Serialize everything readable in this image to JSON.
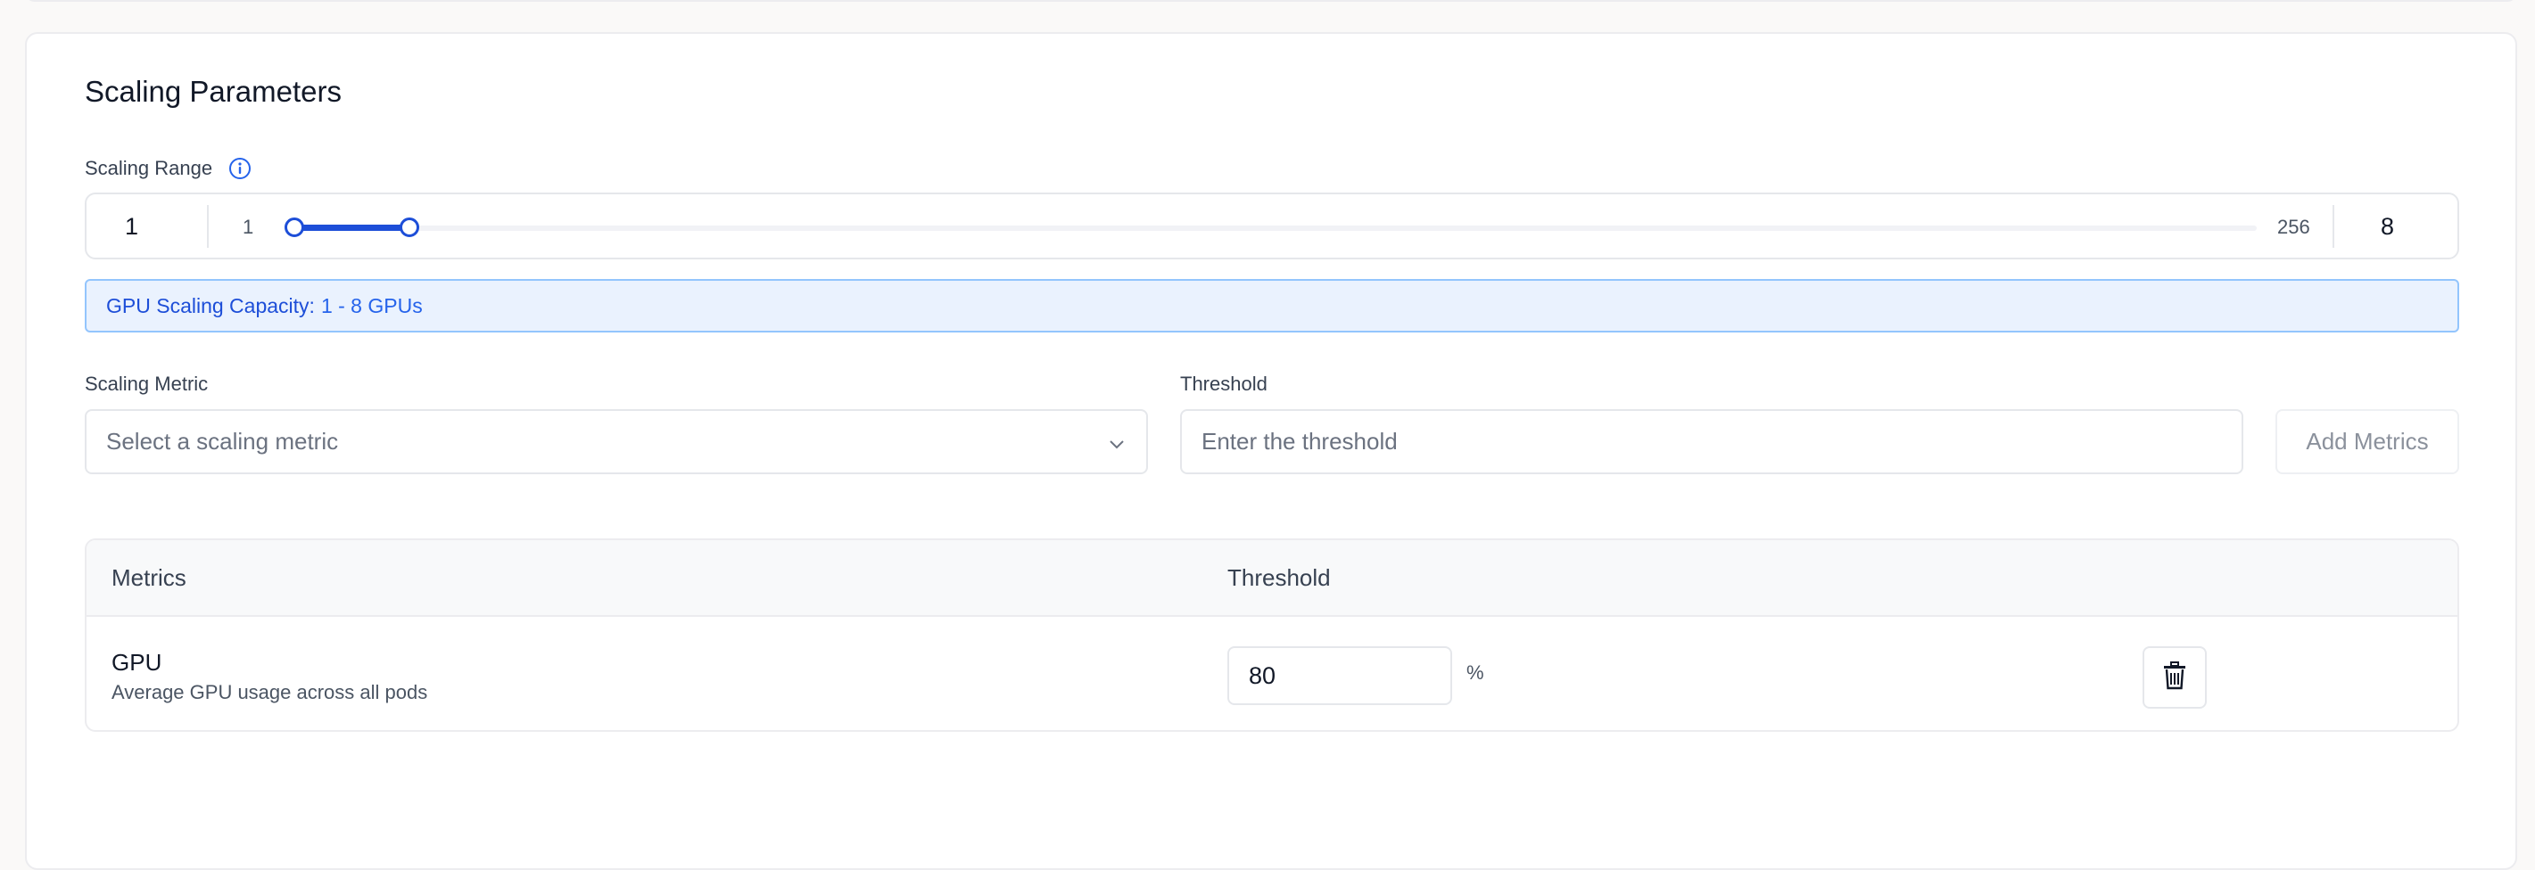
{
  "section": {
    "title": "Scaling Parameters"
  },
  "scaling_range": {
    "label": "Scaling Range",
    "info_icon": "info-circle-icon",
    "min_value": "1",
    "max_value": "8",
    "slider_min_label": "1",
    "slider_max_label": "256",
    "slider_min": 1,
    "slider_max": 256,
    "selected_low": 1,
    "selected_high": 8
  },
  "capacity": {
    "label": "GPU Scaling Capacity:",
    "value": "1 - 8 GPUs"
  },
  "scaling_metric": {
    "label": "Scaling Metric",
    "placeholder": "Select a scaling metric",
    "icon": "chevron-down-icon"
  },
  "threshold": {
    "label": "Threshold",
    "placeholder": "Enter the threshold"
  },
  "add_metrics_label": "Add Metrics",
  "table": {
    "headers": [
      "Metrics",
      "Threshold"
    ],
    "rows": [
      {
        "name": "GPU",
        "description": "Average GPU usage across all pods",
        "threshold": "80",
        "unit": "%",
        "delete_icon": "trash-icon"
      }
    ]
  },
  "colors": {
    "accent": "#1d4ed8",
    "info_bg": "#eaf2fe",
    "info_border": "#93c5fd",
    "border": "#e5e7eb"
  }
}
